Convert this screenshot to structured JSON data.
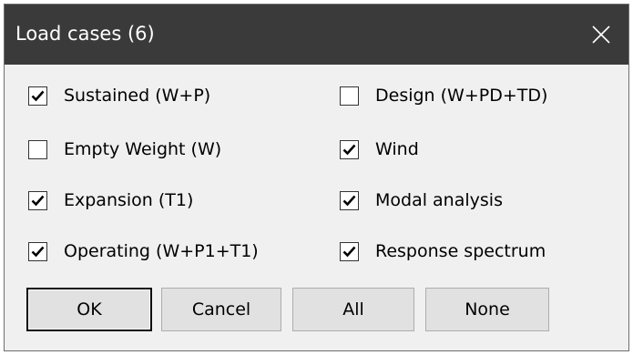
{
  "dialog": {
    "title": "Load cases (6)",
    "close_glyph": "close-icon"
  },
  "checkboxes": {
    "sustained": {
      "label": "Sustained (W+P)",
      "checked": true
    },
    "empty_weight": {
      "label": "Empty Weight (W)",
      "checked": false
    },
    "expansion": {
      "label": "Expansion (T1)",
      "checked": true
    },
    "operating": {
      "label": "Operating (W+P1+T1)",
      "checked": true
    },
    "design": {
      "label": "Design (W+PD+TD)",
      "checked": false
    },
    "wind": {
      "label": "Wind",
      "checked": true
    },
    "modal": {
      "label": "Modal analysis",
      "checked": true
    },
    "response": {
      "label": "Response spectrum",
      "checked": true
    }
  },
  "buttons": {
    "ok": "OK",
    "cancel": "Cancel",
    "all": "All",
    "none": "None"
  },
  "colors": {
    "titlebar": "#3a3a3a",
    "dialog_bg": "#f0f0f0",
    "button_bg": "#e1e1e1"
  }
}
